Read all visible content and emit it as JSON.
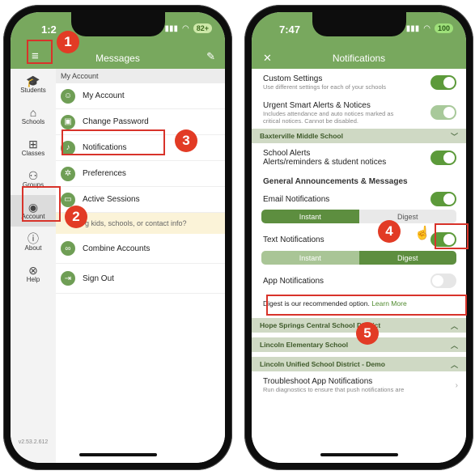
{
  "left_phone": {
    "time": "1:2",
    "battery": "82+",
    "title": "Messages",
    "sidebar": [
      {
        "label": "Students",
        "icon": "graduation-cap-icon"
      },
      {
        "label": "Schools",
        "icon": "school-icon"
      },
      {
        "label": "Classes",
        "icon": "classes-icon"
      },
      {
        "label": "Groups",
        "icon": "groups-icon"
      },
      {
        "label": "Account",
        "icon": "account-icon"
      },
      {
        "label": "About",
        "icon": "info-icon"
      },
      {
        "label": "Help",
        "icon": "help-icon"
      }
    ],
    "menu_header": "My Account",
    "menu": [
      {
        "label": "My Account",
        "icon": "person-icon"
      },
      {
        "label": "Change Password",
        "icon": "lock-icon"
      },
      {
        "label": "Notifications",
        "icon": "bell-icon"
      },
      {
        "label": "Preferences",
        "icon": "settings-icon"
      },
      {
        "label": "Active Sessions",
        "icon": "monitor-icon"
      }
    ],
    "question": "g kids, schools, or contact info?",
    "menu2": [
      {
        "label": "Combine Accounts",
        "icon": "link-icon"
      },
      {
        "label": "Sign Out",
        "icon": "signout-icon"
      }
    ],
    "version": "v2.53.2.612"
  },
  "right_phone": {
    "time": "7:47",
    "battery": "100",
    "title": "Notifications",
    "custom_settings": {
      "title": "Custom Settings",
      "sub": "Use different settings for each of your schools"
    },
    "urgent": {
      "title": "Urgent Smart Alerts & Notices",
      "sub": "Includes attendance and auto notices marked as critical notices. Cannot be disabled."
    },
    "school1": "Baxterville Middle School",
    "school_alerts": {
      "title": "School Alerts",
      "sub": "Alerts/reminders & student notices"
    },
    "general_title": "General Announcements & Messages",
    "email": "Email Notifications",
    "seg_instant": "Instant",
    "seg_digest": "Digest",
    "text": "Text Notifications",
    "app": "App Notifications",
    "digest_note": "Digest is our recommended option.",
    "learn_more": "Learn More",
    "schools": [
      "Hope Springs Central School District",
      "Lincoln Elementary School",
      "Lincoln Unified School District - Demo"
    ],
    "troubleshoot": {
      "title": "Troubleshoot App Notifications",
      "sub": "Run diagnostics to ensure that push notifications are"
    }
  },
  "annotations": [
    "1",
    "2",
    "3",
    "4",
    "5"
  ],
  "colors": {
    "brand_green": "#78a85e",
    "accent_red": "#e23b25"
  }
}
